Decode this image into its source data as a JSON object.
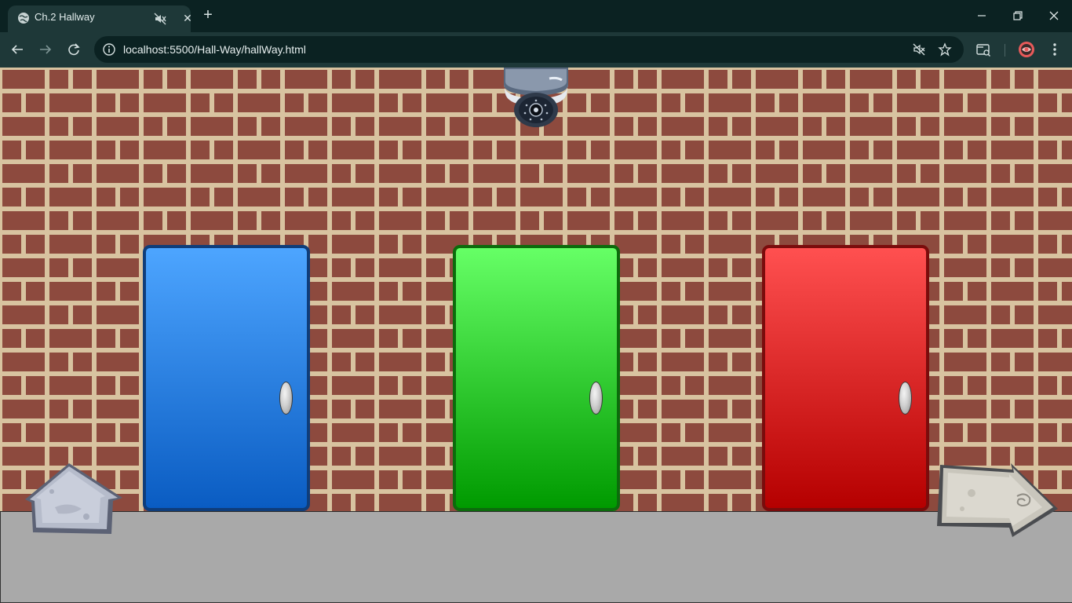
{
  "browser": {
    "tab": {
      "title": "Ch.2 Hallway",
      "favicon": "globe-icon",
      "audio_icon": "muted-speaker-icon",
      "close_label": "✕"
    },
    "new_tab_label": "+",
    "window_controls": [
      "minimize-icon",
      "restore-icon",
      "close-icon"
    ],
    "address_bar": {
      "url": "localhost:5500/Hall-Way/hallWay.html",
      "info_icon": "info-icon"
    },
    "toolbar_icons": [
      "back-icon",
      "forward-icon",
      "reload-icon",
      "muted-speaker-icon",
      "star-icon",
      "tab-search-icon",
      "profile-avatar",
      "menu-icon"
    ]
  },
  "scene": {
    "colors": {
      "brick": "#8d4a3e",
      "mortar": "#d8c3a0",
      "floor": "#a9a9a9"
    },
    "doors": [
      {
        "name": "blue-door",
        "color": "#1e7de8"
      },
      {
        "name": "green-door",
        "color": "#1ecc1e"
      },
      {
        "name": "red-door",
        "color": "#e02020"
      }
    ],
    "props": [
      "security-camera-icon",
      "home-stone-button",
      "next-arrow-stone-button"
    ]
  }
}
